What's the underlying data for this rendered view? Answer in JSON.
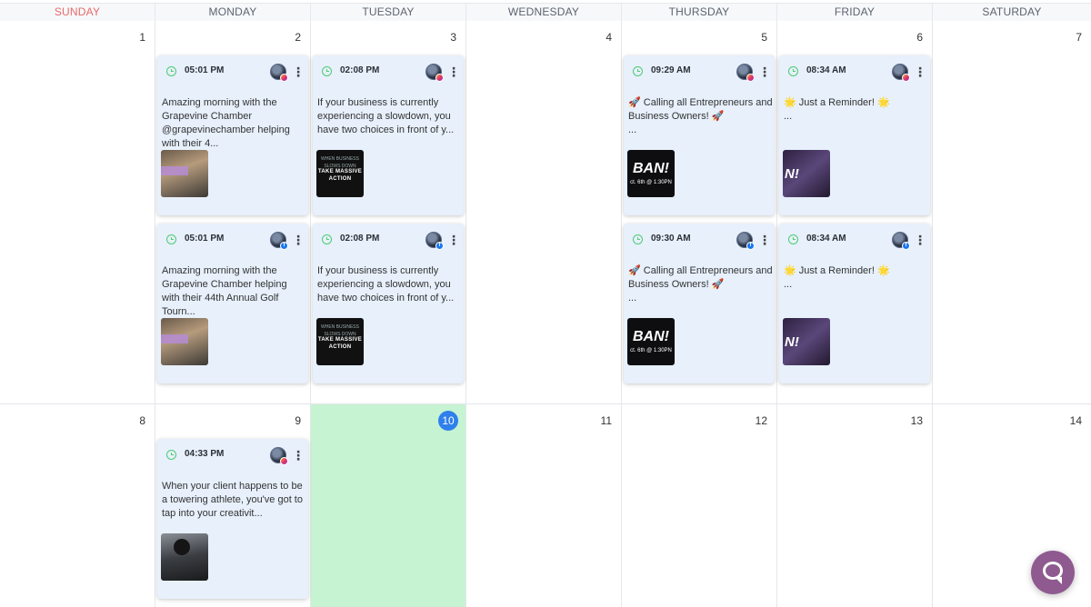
{
  "weekdays": [
    "SUNDAY",
    "MONDAY",
    "TUESDAY",
    "WEDNESDAY",
    "THURSDAY",
    "FRIDAY",
    "SATURDAY"
  ],
  "week1_days": [
    "1",
    "2",
    "3",
    "4",
    "5",
    "6",
    "7"
  ],
  "week2_days": [
    "8",
    "9",
    "10",
    "11",
    "12",
    "13",
    "14"
  ],
  "today": "10",
  "colors": {
    "today_fill": "#c6f3d2",
    "today_badge": "#2f80ed",
    "post_card": "#e7f0fb",
    "clock": "#4ecb72",
    "sunday": "#e86a6a",
    "chat_button": "#8f5a8f"
  },
  "posts": [
    {
      "day": "2",
      "network": "instagram",
      "time": "05:01 PM",
      "text": "Amazing morning with the Grapevine Chamber @grapevinechamber helping with their 4...",
      "thumbnail": "golf-photo"
    },
    {
      "day": "2",
      "network": "facebook",
      "time": "05:01 PM",
      "text": "Amazing morning with the Grapevine Chamber helping with their 44th Annual Golf Tourn...",
      "thumbnail": "golf-photo"
    },
    {
      "day": "3",
      "network": "instagram",
      "time": "02:08 PM",
      "text": "If your business is currently experiencing a slowdown, you have two choices in front of y...",
      "thumbnail": "slowdown-graphic",
      "thumb_line1": "WHEN BUSINESS SLOWS DOWN",
      "thumb_line2": "TAKE MASSIVE ACTION"
    },
    {
      "day": "3",
      "network": "facebook",
      "time": "02:08 PM",
      "text": "If your business is currently experiencing a slowdown, you have two choices in front of y...",
      "thumbnail": "slowdown-graphic",
      "thumb_line1": "WHEN BUSINESS SLOWS DOWN",
      "thumb_line2": "TAKE MASSIVE ACTION"
    },
    {
      "day": "5",
      "network": "instagram",
      "time": "09:29 AM",
      "text": "🚀 Calling all Entrepreneurs and Business Owners! 🚀\n...",
      "thumbnail": "bam-graphic",
      "thumb_big": "BAN!",
      "thumb_small": "ct. 6th @ 1:30PN"
    },
    {
      "day": "5",
      "network": "facebook",
      "time": "09:30 AM",
      "text": "🚀 Calling all Entrepreneurs and Business Owners! 🚀\n...",
      "thumbnail": "bam-graphic",
      "thumb_big": "BAN!",
      "thumb_small": "ct. 6th @ 1:30PN"
    },
    {
      "day": "6",
      "network": "instagram",
      "time": "08:34 AM",
      "text": "🌟 Just a Reminder! 🌟\n...",
      "thumbnail": "purple-graphic",
      "thumb_big": "N!"
    },
    {
      "day": "6",
      "network": "facebook",
      "time": "08:34 AM",
      "text": "🌟 Just a Reminder! 🌟\n...",
      "thumbnail": "purple-graphic",
      "thumb_big": "N!"
    },
    {
      "day": "9",
      "network": "instagram",
      "time": "04:33 PM",
      "text": "When your client happens to be a towering athlete, you've got to tap into your creativit...",
      "thumbnail": "athlete-photo"
    }
  ],
  "icons": {
    "clock": "clock-icon",
    "menu": "more-vertical-icon",
    "instagram": "instagram-icon",
    "facebook": "facebook-icon",
    "chat": "chat-icon"
  }
}
